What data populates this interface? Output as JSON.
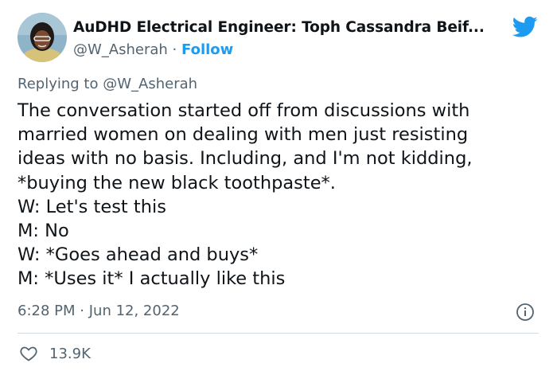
{
  "author": {
    "display_name": "AuDHD Electrical Engineer: Toph Cassandra Beif...",
    "handle": "@W_Asherah",
    "separator": "·",
    "follow_label": "Follow"
  },
  "reply": {
    "prefix": "Replying to",
    "mention": "@W_Asherah"
  },
  "body_lines": [
    "The conversation started off from discussions with",
    "married women on dealing with men just resisting",
    "ideas with no basis. Including, and I'm not kidding,",
    "*buying the new black toothpaste*.",
    "W: Let's test this",
    "M: No",
    "W: *Goes ahead and buys*",
    "M: *Uses it* I actually like this"
  ],
  "meta": {
    "time": "6:28 PM",
    "separator": "·",
    "date": "Jun 12, 2022"
  },
  "engagement": {
    "likes": "13.9K"
  },
  "icons": {
    "brand": "twitter-bird-icon",
    "info": "info-icon",
    "like": "heart-icon"
  },
  "colors": {
    "accent": "#1d9bf0",
    "text": "#0f1419",
    "muted": "#536471",
    "divider": "#cfd9de"
  }
}
